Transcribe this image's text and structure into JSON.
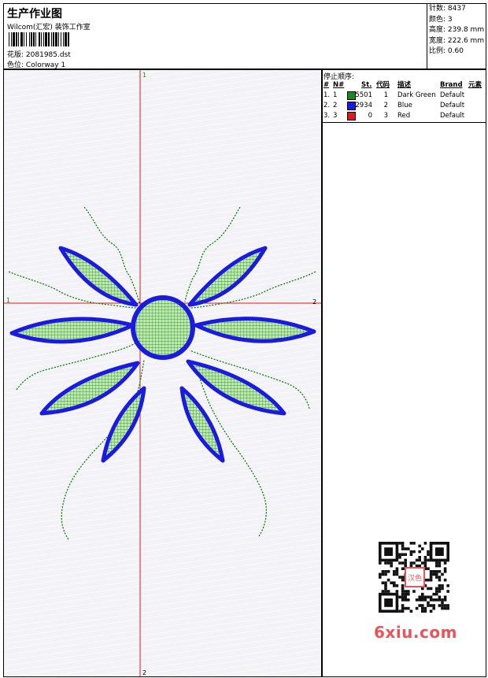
{
  "header": {
    "title": "生产作业图",
    "subtitle": "Wilcom(汇宏) 装饰工作室",
    "design_label": "花版:",
    "design_value": "2081985.dst",
    "color_label": "色位:",
    "color_value": "Colorway 1"
  },
  "stats": [
    {
      "label": "针数:",
      "value": "8437"
    },
    {
      "label": "颜色:",
      "value": "3"
    },
    {
      "label": "高度:",
      "value": "239.8 mm"
    },
    {
      "label": "宽度:",
      "value": "222.6 mm"
    },
    {
      "label": "比例:",
      "value": "0.60"
    }
  ],
  "axes": {
    "v_top": "1",
    "v_bottom": "2",
    "h_left": "1",
    "h_right": "2"
  },
  "stops": {
    "title": "停止顺序:",
    "columns": [
      "#",
      "N#",
      "St.",
      "代码",
      "描述",
      "Brand",
      "元素"
    ],
    "rows": [
      {
        "num": "1.",
        "n": "1",
        "color": "#1a8a1a",
        "st": "5501",
        "code": "1",
        "desc": "Dark Green",
        "brand": "Default"
      },
      {
        "num": "2.",
        "n": "2",
        "color": "#1a1ae0",
        "st": "2934",
        "code": "2",
        "desc": "Blue",
        "brand": "Default"
      },
      {
        "num": "3.",
        "n": "3",
        "color": "#e01a1a",
        "st": "0",
        "code": "3",
        "desc": "Red",
        "brand": "Default"
      }
    ]
  },
  "watermark": {
    "logo_text": "6xiu.com",
    "qr_center_text": "汉色"
  },
  "colors": {
    "green": "#1a8a1a",
    "blue": "#1a1ae0",
    "red": "#e01a1a",
    "leaf_fill": "#bfe8b0"
  }
}
